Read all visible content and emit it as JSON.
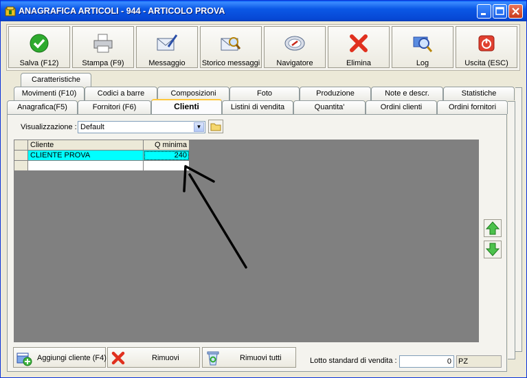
{
  "window": {
    "title": "ANAGRAFICA ARTICOLI - 944 - ARTICOLO PROVA"
  },
  "toolbar": [
    {
      "label": "Salva (F12)",
      "icon": "check-icon"
    },
    {
      "label": "Stampa (F9)",
      "icon": "printer-icon"
    },
    {
      "label": "Messaggio",
      "icon": "envelope-pen-icon"
    },
    {
      "label": "Storico messaggi",
      "icon": "envelope-search-icon"
    },
    {
      "label": "Navigatore",
      "icon": "compass-icon"
    },
    {
      "label": "Elimina",
      "icon": "delete-x-icon"
    },
    {
      "label": "Log",
      "icon": "magnifier-icon"
    },
    {
      "label": "Uscita (ESC)",
      "icon": "exit-icon"
    }
  ],
  "tabs": {
    "row1": [
      "Caratteristiche"
    ],
    "row2": [
      "Movimenti (F10)",
      "Codici a barre",
      "Composizioni",
      "Foto",
      "Produzione",
      "Note e descr.",
      "Statistiche"
    ],
    "row3": [
      "Anagrafica(F5)",
      "Fornitori (F6)",
      "Clienti",
      "Listini di vendita",
      "Quantita'",
      "Ordini clienti",
      "Ordini fornitori"
    ],
    "active": "Clienti"
  },
  "view": {
    "label": "Visualizzazione :",
    "value": "Default"
  },
  "grid": {
    "columns": [
      "Cliente",
      "Q minima"
    ],
    "rows": [
      {
        "cliente": "CLIENTE PROVA",
        "q_minima": "240"
      }
    ]
  },
  "buttons": {
    "add": "Aggiungi cliente (F4)",
    "remove": "Rimuovi",
    "remove_all": "Rimuovi tutti"
  },
  "lotto": {
    "label": "Lotto standard di vendita :",
    "value": "0",
    "unit": "PZ"
  },
  "colors": {
    "selected_row": "#00FFFF",
    "grid_bg": "#808080",
    "titlebar": "#0A5FF5"
  }
}
